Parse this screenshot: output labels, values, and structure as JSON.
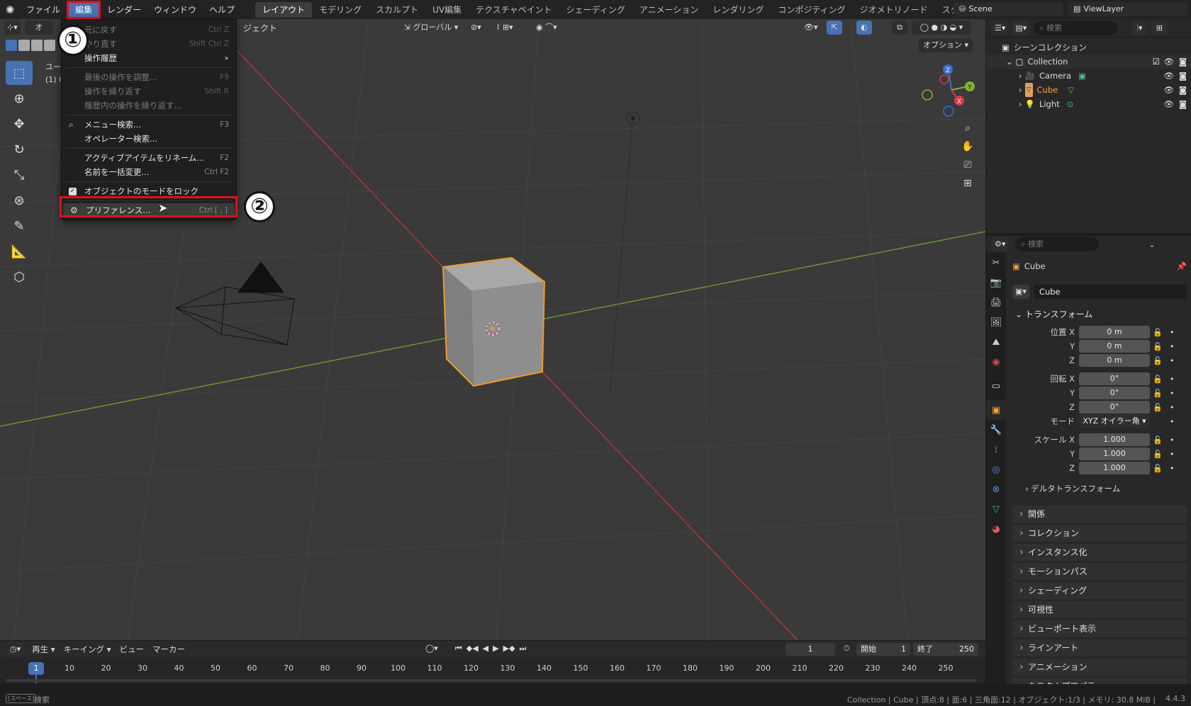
{
  "topbar": {
    "menus": [
      "ファイル",
      "編集",
      "レンダー",
      "ウィンドウ",
      "ヘルプ"
    ],
    "workspaces": [
      "レイアウト",
      "モデリング",
      "スカルプト",
      "UV編集",
      "テクスチャペイント",
      "シェーディング",
      "アニメーション",
      "レンダリング",
      "コンポジティング",
      "ジオメトリノード",
      "スクリプト作成"
    ],
    "active_workspace": "レイアウト",
    "add_tab": "+",
    "scene": "Scene",
    "view_layer": "ViewLayer"
  },
  "viewport": {
    "header_obj": "オ",
    "header_obj_rest": "ジェクト",
    "orientation": "グローバル",
    "options": "オプション",
    "overlay_text1": "ユー",
    "overlay_text2": "(1) C"
  },
  "edit_menu": {
    "items": [
      {
        "label": "元に戻す",
        "shortcut": "Ctrl Z",
        "dim": true
      },
      {
        "label": "やり直す",
        "shortcut": "Shift Ctrl Z",
        "dim": true
      },
      {
        "label": "操作履歴",
        "shortcut": "▸",
        "dim": false
      },
      {
        "label": "最後の操作を調整...",
        "shortcut": "F9",
        "dim": true
      },
      {
        "label": "操作を繰り返す",
        "shortcut": "Shift R",
        "dim": true
      },
      {
        "label": "履歴内の操作を繰り返す...",
        "shortcut": "",
        "dim": true
      },
      {
        "label": "メニュー検索...",
        "shortcut": "F3",
        "dim": false
      },
      {
        "label": "オペレーター検索...",
        "shortcut": "",
        "dim": false
      },
      {
        "label": "アクティブアイテムをリネーム...",
        "shortcut": "F2",
        "dim": false
      },
      {
        "label": "名前を一括変更...",
        "shortcut": "Ctrl F2",
        "dim": false
      },
      {
        "label": "オブジェクトのモードをロック",
        "shortcut": "",
        "dim": false
      },
      {
        "label": "プリファレンス...",
        "shortcut": "Ctrl [ , ]",
        "dim": false
      }
    ]
  },
  "annotations": {
    "step1": "①",
    "step2": "②"
  },
  "outliner": {
    "search_placeholder": "検索",
    "scene_collection": "シーンコレクション",
    "collection": "Collection",
    "objects": [
      "Camera",
      "Cube",
      "Light"
    ]
  },
  "properties": {
    "search_placeholder": "検索",
    "object_name": "Cube",
    "data_name": "Cube",
    "transform_title": "トランスフォーム",
    "location_label": "位置 X",
    "rotation_label": "回転 X",
    "mode_label": "モード",
    "scale_label": "スケール X",
    "axis_y": "Y",
    "axis_z": "Z",
    "location": [
      "0 m",
      "0 m",
      "0 m"
    ],
    "rotation": [
      "0°",
      "0°",
      "0°"
    ],
    "mode": "XYZ オイラー角",
    "scale": [
      "1.000",
      "1.000",
      "1.000"
    ],
    "delta": "デルタトランスフォーム",
    "sections": [
      "関係",
      "コレクション",
      "インスタンス化",
      "モーションパス",
      "シェーディング",
      "可視性",
      "ビューポート表示",
      "ラインアート",
      "アニメーション",
      "カスタムプロパティ"
    ]
  },
  "timeline": {
    "menus": [
      "再生",
      "キーイング",
      "ビュー",
      "マーカー"
    ],
    "current_frame": "1",
    "start_label": "開始",
    "start": "1",
    "end_label": "終了",
    "end": "250",
    "ticks": [
      "10",
      "20",
      "30",
      "40",
      "50",
      "60",
      "70",
      "80",
      "90",
      "100",
      "110",
      "120",
      "130",
      "140",
      "150",
      "160",
      "170",
      "180",
      "190",
      "200",
      "210",
      "220",
      "230",
      "240",
      "250"
    ],
    "playhead": "1"
  },
  "statusbar": {
    "left_key": "[スペース]",
    "left_text": "検索",
    "right": "Collection | Cube | 頂点:8 | 面:6 | 三角面:12 | オブジェクト:1/3 | メモリ: 30.8 MiB | ",
    "version": "4.4.3"
  }
}
